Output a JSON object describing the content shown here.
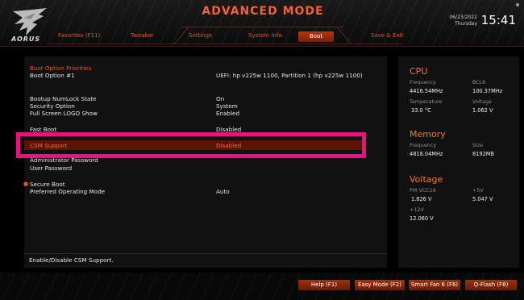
{
  "header": {
    "logo_text": "AORUS",
    "mode_title": "ADVANCED MODE",
    "date": "06/23/2022",
    "day": "Thursday",
    "time": "15:41"
  },
  "tabs": [
    {
      "label": "Favorites (F11)"
    },
    {
      "label": "Tweaker"
    },
    {
      "label": "Settings"
    },
    {
      "label": "System Info."
    },
    {
      "label": "Boot",
      "active": true
    },
    {
      "label": "Save & Exit"
    }
  ],
  "boot": {
    "section_title": "Boot Option Priorities",
    "boot_option_1_label": "Boot Option #1",
    "boot_option_1_value": "UEFI: hp v225w 1100, Partition 1 (hp v225w 1100)",
    "numlock_label": "Bootup NumLock State",
    "numlock_value": "On",
    "security_label": "Security Option",
    "security_value": "System",
    "logo_label": "Full Screen LOGO Show",
    "logo_value": "Enabled",
    "fastboot_label": "Fast Boot",
    "fastboot_value": "Disabled",
    "csm_label": "CSM Support",
    "csm_value": "Disabled",
    "admin_pw_label": "Administrator Password",
    "user_pw_label": "User Password",
    "secure_boot_label": "Secure Boot",
    "pref_mode_label": "Preferred Operating Mode",
    "pref_mode_value": "Auto"
  },
  "help_text": "Enable/Disable CSM Support.",
  "cpu": {
    "title": "CPU",
    "freq_label": "Frequency",
    "freq_value": "4416.54MHz",
    "bclk_label": "BCLK",
    "bclk_value": "100.37MHz",
    "temp_label": "Temperature",
    "temp_value": "33.0 °C",
    "volt_label": "Voltage",
    "volt_value": "1.062 V"
  },
  "memory": {
    "title": "Memory",
    "freq_label": "Frequency",
    "freq_value": "4818.04MHz",
    "size_label": "Size",
    "size_value": "8192MB"
  },
  "voltage": {
    "title": "Voltage",
    "vcc18_label": "PM VCC18",
    "vcc18_value": "1.826 V",
    "p5v_label": "+5V",
    "p5v_value": "5.047 V",
    "p12v_label": "+12V",
    "p12v_value": "12.060 V"
  },
  "footer": {
    "help": "Help (F1)",
    "easy_mode": "Easy Mode (F2)",
    "smart_fan": "Smart Fan 6 (F6)",
    "qflash": "Q-Flash (F8)"
  },
  "colors": {
    "accent": "#e2542c",
    "highlight_bg": "#5a1304",
    "callout": "#e8137e"
  }
}
